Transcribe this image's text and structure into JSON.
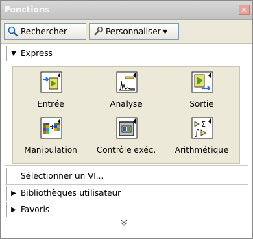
{
  "window": {
    "title": "Fonctions",
    "close_glyph": "✕"
  },
  "toolbar": {
    "search_label": "Rechercher",
    "customize_label": "Personnaliser"
  },
  "express": {
    "label": "Express",
    "tiles": [
      {
        "label": "Entrée",
        "icon": "input-icon"
      },
      {
        "label": "Analyse",
        "icon": "analysis-icon"
      },
      {
        "label": "Sortie",
        "icon": "output-icon"
      },
      {
        "label": "Manipulation",
        "icon": "signal-manipulation-icon"
      },
      {
        "label": "Contrôle exéc.",
        "icon": "exec-control-icon"
      },
      {
        "label": "Arithmétique",
        "icon": "arithmetic-icon"
      }
    ]
  },
  "items": {
    "select_vi": "Sélectionner un VI...",
    "user_libraries": "Bibliothèques utilisateur",
    "favorites": "Favoris"
  }
}
